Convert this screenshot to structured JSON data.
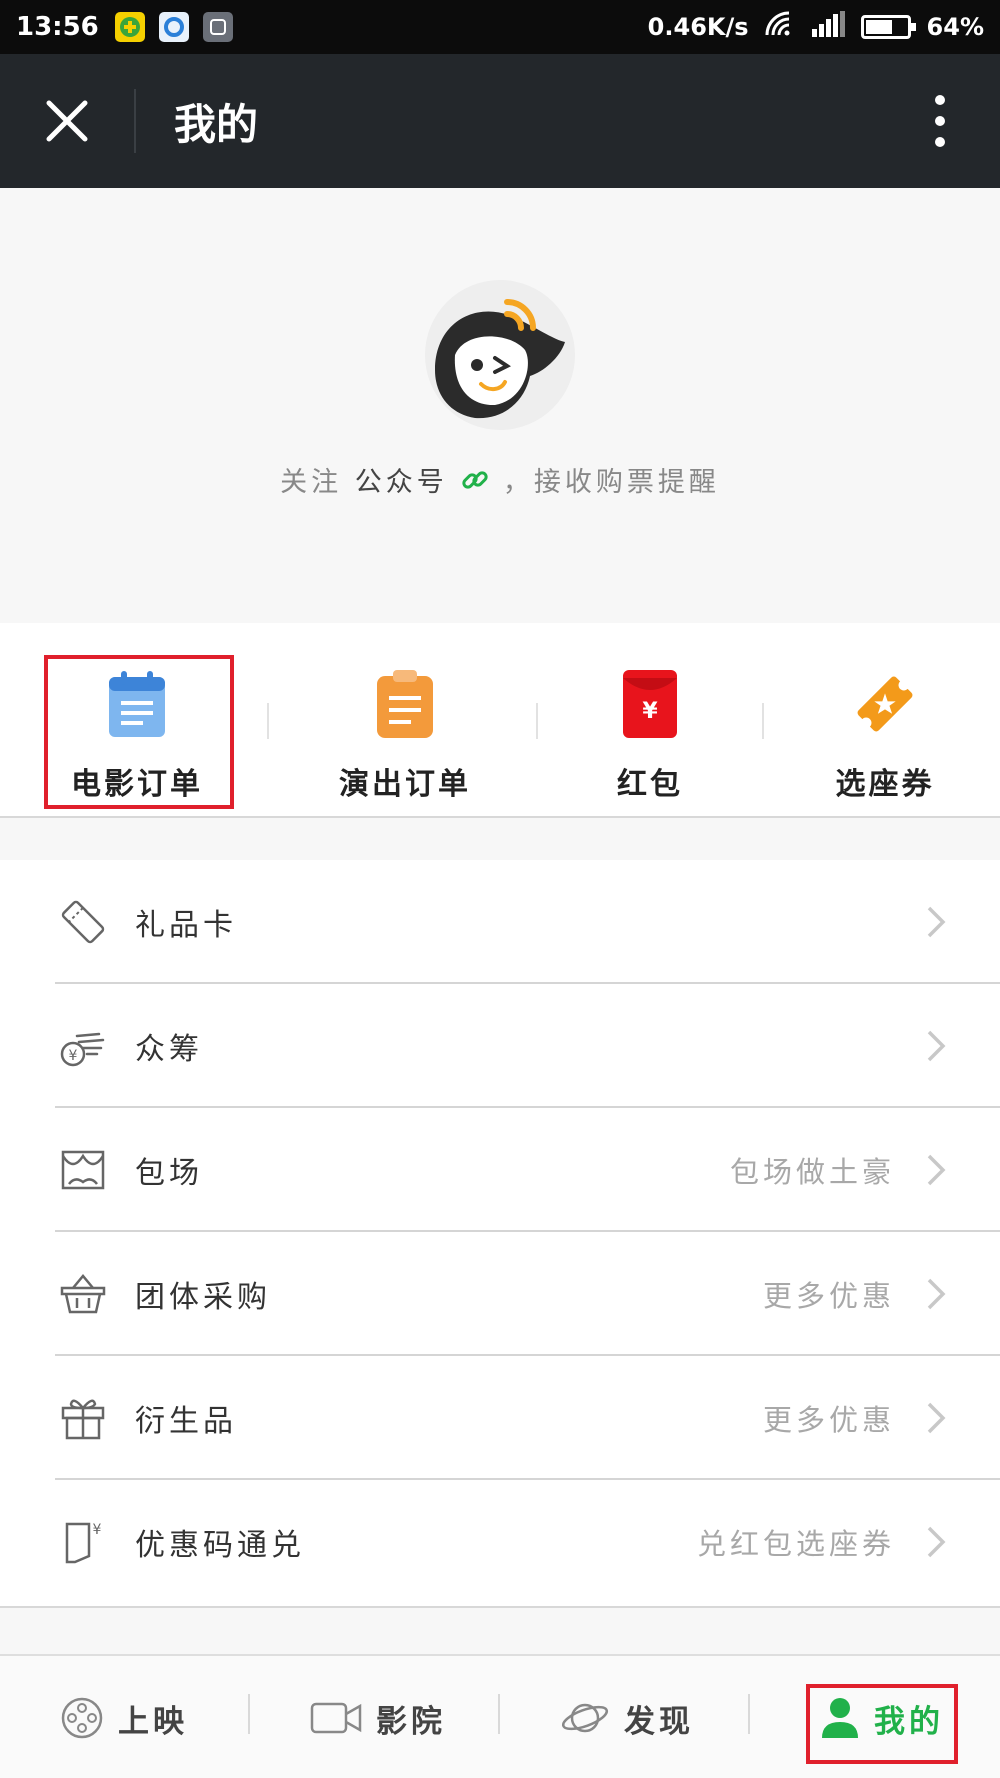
{
  "status_bar": {
    "time": "13:56",
    "net_speed": "0.46K/s",
    "battery": "64%",
    "battery_level": 0.64
  },
  "title_bar": {
    "title": "我的"
  },
  "profile": {
    "follow_prefix": "关注",
    "follow_account": "公众号",
    "follow_suffix": "，接收购票提醒"
  },
  "quick_actions": [
    {
      "label": "电影订单",
      "icon": "calendar-icon",
      "color": "#6fa8e6"
    },
    {
      "label": "演出订单",
      "icon": "clipboard-icon",
      "color": "#f39a3b"
    },
    {
      "label": "红包",
      "icon": "red-envelope-icon",
      "color": "#e8141c"
    },
    {
      "label": "选座券",
      "icon": "ticket-star-icon",
      "color": "#f39a1a"
    }
  ],
  "menu": [
    {
      "label": "礼品卡",
      "hint": "",
      "icon": "gift-card-icon"
    },
    {
      "label": "众筹",
      "hint": "",
      "icon": "crowdfunding-hand-icon"
    },
    {
      "label": "包场",
      "hint": "包场做土豪",
      "icon": "theater-icon"
    },
    {
      "label": "团体采购",
      "hint": "更多优惠",
      "icon": "basket-icon"
    },
    {
      "label": "衍生品",
      "hint": "更多优惠",
      "icon": "gift-box-icon"
    },
    {
      "label": "优惠码通兑",
      "hint": "兑红包选座券",
      "icon": "coupon-code-icon"
    }
  ],
  "tab_bar": [
    {
      "label": "上映",
      "icon": "film-reel-icon",
      "active": false
    },
    {
      "label": "影院",
      "icon": "camera-icon",
      "active": false
    },
    {
      "label": "发现",
      "icon": "planet-icon",
      "active": false
    },
    {
      "label": "我的",
      "icon": "user-icon",
      "active": true
    }
  ],
  "colors": {
    "accent_green": "#21b14a",
    "highlight_red": "#e0202c",
    "title_bar_bg": "#23272b"
  }
}
